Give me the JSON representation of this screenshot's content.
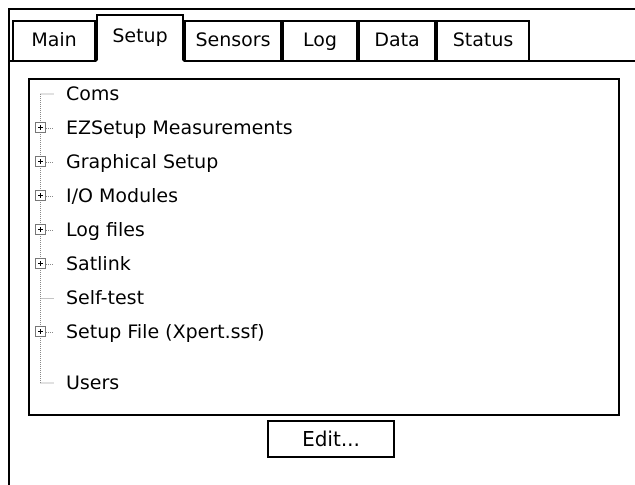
{
  "tabs": [
    {
      "label": "Main"
    },
    {
      "label": "Setup",
      "active": true
    },
    {
      "label": "Sensors"
    },
    {
      "label": "Log"
    },
    {
      "label": "Data"
    },
    {
      "label": "Status"
    }
  ],
  "tree": {
    "items": [
      {
        "label": "Coms",
        "expandable": false
      },
      {
        "label": "EZSetup Measurements",
        "expandable": true
      },
      {
        "label": "Graphical Setup",
        "expandable": true
      },
      {
        "label": "I/O Modules",
        "expandable": true
      },
      {
        "label": "Log files",
        "expandable": true
      },
      {
        "label": "Satlink",
        "expandable": true
      },
      {
        "label": "Self-test",
        "expandable": false
      },
      {
        "label": "Setup File (Xpert.ssf)",
        "expandable": true
      },
      {
        "label": "Users",
        "expandable": false
      }
    ]
  },
  "edit_button": {
    "label": "Edit..."
  }
}
